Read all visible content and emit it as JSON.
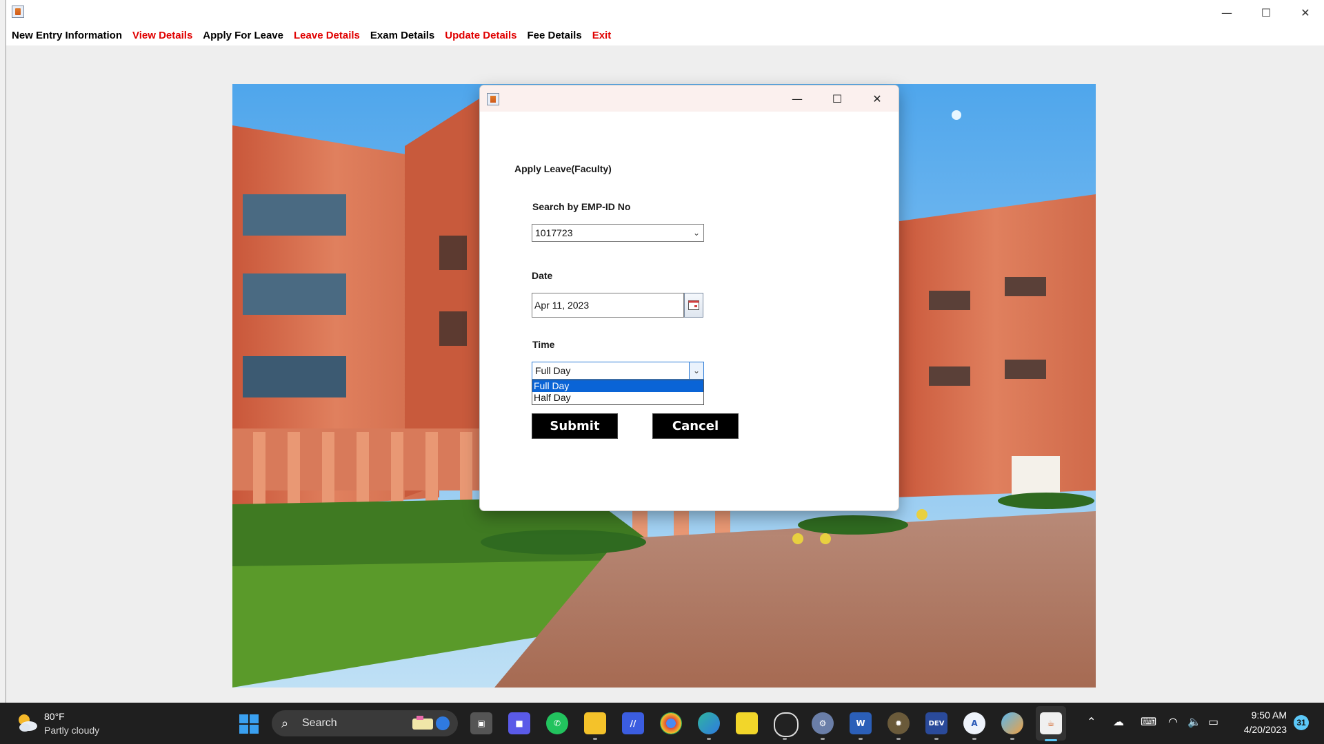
{
  "menubar": {
    "items": [
      {
        "label": "New Entry Information",
        "color": "#000000"
      },
      {
        "label": "View Details",
        "color": "#e00000"
      },
      {
        "label": "Apply For Leave",
        "color": "#000000"
      },
      {
        "label": "Leave Details",
        "color": "#e00000"
      },
      {
        "label": "Exam Details",
        "color": "#000000"
      },
      {
        "label": "Update Details",
        "color": "#e00000"
      },
      {
        "label": "Fee Details",
        "color": "#000000"
      },
      {
        "label": "Exit",
        "color": "#e00000"
      }
    ]
  },
  "dialog": {
    "heading": "Apply Leave(Faculty)",
    "emp_label": "Search by EMP-ID No",
    "emp_value": "1017723",
    "date_label": "Date",
    "date_value": "Apr 11, 2023",
    "time_label": "Time",
    "time_value": "Full Day",
    "time_options": [
      "Full Day",
      "Half Day"
    ],
    "submit_label": "Submit",
    "cancel_label": "Cancel"
  },
  "taskbar": {
    "weather_temp": "80°F",
    "weather_desc": "Partly cloudy",
    "search_label": "Search",
    "clock_time": "9:50 AM",
    "clock_date": "4/20/2023",
    "notification_count": "31",
    "apps": [
      "file-manager-icon",
      "zoom-icon",
      "whatsapp-icon",
      "explorer-icon",
      "vscode-icon",
      "chrome-icon",
      "edge-icon",
      "sticky-notes-icon",
      "obs-icon",
      "settings-icon",
      "word-icon",
      "tool-icon",
      "dev-icon",
      "writer-icon",
      "paint-icon",
      "java-icon"
    ]
  },
  "colors": {
    "accent": "#0a64d6",
    "menu_red": "#e00000",
    "taskbar": "#1f1f1f"
  }
}
